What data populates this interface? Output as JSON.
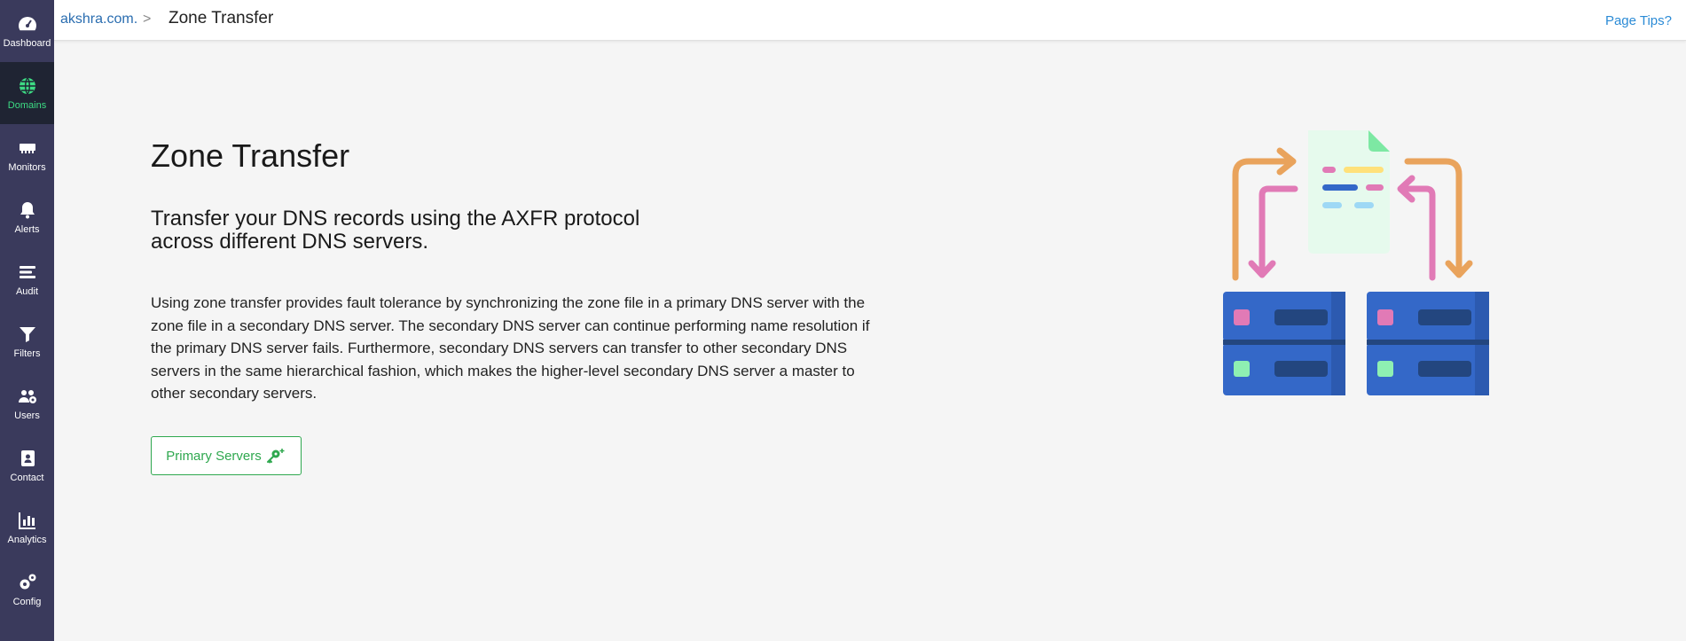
{
  "sidebar": {
    "items": [
      {
        "label": "Dashboard",
        "icon": "gauge-icon"
      },
      {
        "label": "Domains",
        "icon": "globe-icon",
        "active": true
      },
      {
        "label": "Monitors",
        "icon": "monitor-icon"
      },
      {
        "label": "Alerts",
        "icon": "bell-icon"
      },
      {
        "label": "Audit",
        "icon": "list-icon"
      },
      {
        "label": "Filters",
        "icon": "filter-icon"
      },
      {
        "label": "Users",
        "icon": "users-icon"
      },
      {
        "label": "Contact",
        "icon": "contact-icon"
      },
      {
        "label": "Analytics",
        "icon": "chart-icon"
      },
      {
        "label": "Config",
        "icon": "gears-icon"
      }
    ]
  },
  "header": {
    "breadcrumb_domain": "akshra.com.",
    "breadcrumb_separator": ">",
    "breadcrumb_current": "Zone Transfer",
    "page_tips": "Page Tips?"
  },
  "main": {
    "title": "Zone Transfer",
    "subtitle": "Transfer your DNS records using the AXFR protocol across different DNS servers.",
    "description": "Using zone transfer provides fault tolerance by synchronizing the zone file in a primary DNS server with the zone file in a secondary DNS server. The secondary DNS server can continue performing name resolution if the primary DNS server fails. Furthermore, secondary DNS servers can transfer to other secondary DNS servers in the same hierarchical fashion, which makes the higher-level secondary DNS server a master to other secondary servers.",
    "primary_button": "Primary Servers",
    "primary_button_icon": "key-plus-icon"
  },
  "colors": {
    "sidebar_bg": "#3a3a5c",
    "sidebar_active_bg": "#1f2433",
    "active_green": "#3ddc84",
    "link_blue": "#2a6db0",
    "button_green": "#2fa84f"
  }
}
